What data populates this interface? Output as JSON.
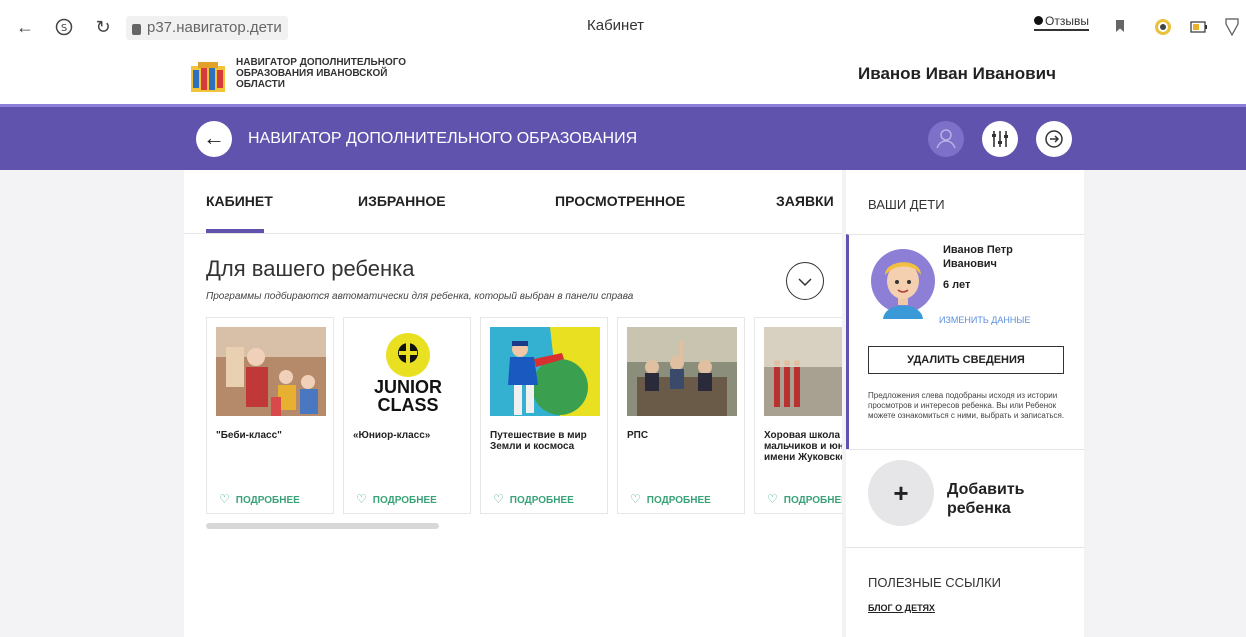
{
  "browser": {
    "url": "p37.навигатор.дети",
    "tab_title": "Кабинет",
    "feedback_label": "Отзывы"
  },
  "header": {
    "logo_text": "НАВИГАТОР ДОПОЛНИТЕЛЬНОГО ОБРАЗОВАНИЯ ИВАНОВСКОЙ ОБЛАСТИ",
    "user_name": "Иванов Иван Иванович"
  },
  "navbar": {
    "title": "НАВИГАТОР ДОПОЛНИТЕЛЬНОГО ОБРАЗОВАНИЯ"
  },
  "tabs": [
    {
      "label": "КАБИНЕТ",
      "active": true
    },
    {
      "label": "ИЗБРАННОЕ",
      "active": false
    },
    {
      "label": "ПРОСМОТРЕННОЕ",
      "active": false
    },
    {
      "label": "ЗАЯВКИ",
      "active": false
    }
  ],
  "recommendations": {
    "title": "Для вашего ребенка",
    "subtitle": "Программы подбираются автоматически для ребенка, который выбран в панели справа",
    "more_label": "ПОДРОБНЕЕ",
    "cards": [
      {
        "title": "\"Беби-класс\""
      },
      {
        "title": "«Юниор-класс»"
      },
      {
        "title": "Путешествие в мир Земли и космоса"
      },
      {
        "title": "РПС"
      },
      {
        "title": "Хоровая школа мальчиков и юношей имени Жуковского"
      }
    ]
  },
  "sidebar": {
    "heading": "ВАШИ ДЕТИ",
    "child": {
      "name": "Иванов Петр Иванович",
      "age": "6 лет",
      "edit_label": "ИЗМЕНИТЬ ДАННЫЕ",
      "delete_label": "УДАЛИТЬ СВЕДЕНИЯ",
      "note": "Предложения слева подобраны исходя из истории просмотров и интересов ребенка. Вы или Ребенок можете ознакомиться с ними, выбрать и записаться."
    },
    "add_child_label": "Добавить ребенка",
    "links_heading": "ПОЛЕЗНЫЕ ССЫЛКИ",
    "blog_link": "БЛОГ О ДЕТЯХ"
  },
  "colors": {
    "accent": "#6053ae",
    "link_green": "#3aa278"
  }
}
